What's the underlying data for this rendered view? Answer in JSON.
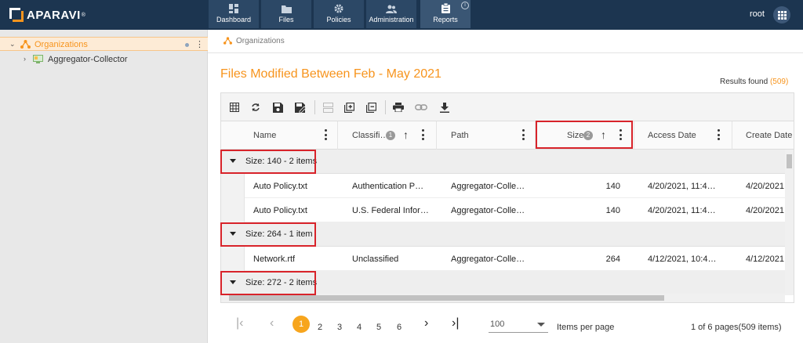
{
  "app": {
    "logo_text": "APARAVI",
    "logo_reg": "®",
    "user": "root"
  },
  "nav": {
    "tabs": [
      {
        "label": "Dashboard",
        "icon": "dashboard-icon"
      },
      {
        "label": "Files",
        "icon": "folder-icon"
      },
      {
        "label": "Policies",
        "icon": "gear-icon"
      },
      {
        "label": "Administration",
        "icon": "users-icon"
      },
      {
        "label": "Reports",
        "icon": "clipboard-icon",
        "active": true
      }
    ],
    "info_glyph": "i"
  },
  "tree": {
    "root": {
      "label": "Organizations",
      "icon": "organization-icon"
    },
    "child": {
      "label": "Aggregator-Collector",
      "icon": "computer-icon"
    }
  },
  "breadcrumb": {
    "label": "Organizations"
  },
  "report": {
    "title": "Files Modified Between Feb - May 2021",
    "results_label": "Results found",
    "results_count": "(509)"
  },
  "toolbar_icons": [
    "table-icon",
    "refresh-icon",
    "save-icon",
    "save-as-icon",
    "collapse-icon",
    "add-widget-icon",
    "copy-icon",
    "print-icon",
    "link-icon",
    "download-icon"
  ],
  "columns": [
    {
      "label": "Name"
    },
    {
      "label": "Classifi…",
      "badge": "1"
    },
    {
      "label": "Path"
    },
    {
      "label": "Size",
      "badge": "2"
    },
    {
      "label": "Access Date"
    },
    {
      "label": "Create Date"
    }
  ],
  "sort_arrow": "↑",
  "groups": [
    {
      "label": "Size: 140 - 2 items",
      "rows": [
        {
          "name": "Auto Policy.txt",
          "classification": "Authentication P…",
          "path": "Aggregator-Colle…",
          "size": "140",
          "access": "4/20/2021, 11:4…",
          "create": "4/20/2021"
        },
        {
          "name": "Auto Policy.txt",
          "classification": "U.S. Federal Infor…",
          "path": "Aggregator-Colle…",
          "size": "140",
          "access": "4/20/2021, 11:4…",
          "create": "4/20/2021"
        }
      ]
    },
    {
      "label": "Size: 264 - 1 item",
      "rows": [
        {
          "name": "Network.rtf",
          "classification": "Unclassified",
          "path": "Aggregator-Colle…",
          "size": "264",
          "access": "4/12/2021, 10:4…",
          "create": "4/12/2021"
        }
      ]
    },
    {
      "label": "Size: 272 - 2 items",
      "rows": []
    }
  ],
  "pagination": {
    "first": "|‹",
    "prev": "‹",
    "next": "›",
    "last": "›|",
    "pages": [
      "1",
      "2",
      "3",
      "4",
      "5",
      "6"
    ],
    "current": "1",
    "per_page": "100",
    "per_page_label": "Items per page",
    "summary": "1 of 6 pages(509 items)"
  },
  "colors": {
    "accent": "#f7941d",
    "nav_bg": "#1c3550",
    "highlight": "#d8232a"
  }
}
